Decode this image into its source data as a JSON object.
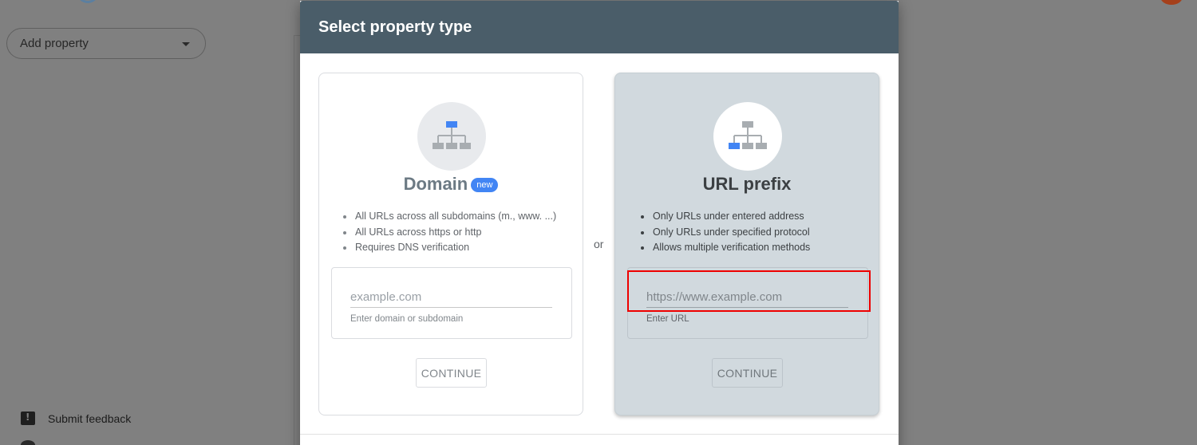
{
  "background": {
    "add_property_label": "Add property",
    "submit_feedback_label": "Submit feedback"
  },
  "dialog": {
    "title": "Select property type",
    "or_label": "or",
    "domain": {
      "title": "Domain",
      "badge": "new",
      "bullets": [
        "All URLs across all subdomains (m., www. ...)",
        "All URLs across https or http",
        "Requires DNS verification"
      ],
      "placeholder": "example.com",
      "helper": "Enter domain or subdomain",
      "continue_label": "CONTINUE"
    },
    "url_prefix": {
      "title": "URL prefix",
      "bullets": [
        "Only URLs under entered address",
        "Only URLs under specified protocol",
        "Allows multiple verification methods"
      ],
      "placeholder": "https://www.example.com",
      "helper": "Enter URL",
      "continue_label": "CONTINUE"
    }
  },
  "colors": {
    "header": "#4a5d69",
    "accent_blue": "#4285f4",
    "highlight_red": "#ee0000"
  }
}
